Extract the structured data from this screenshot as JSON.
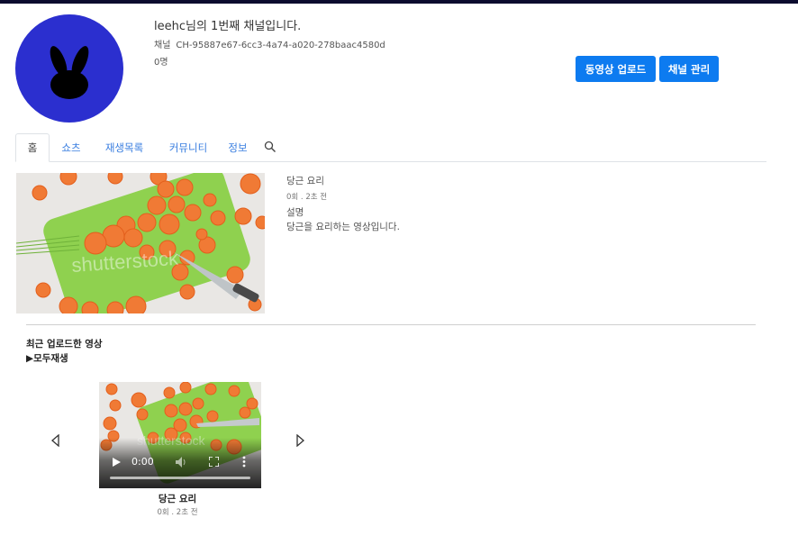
{
  "channel": {
    "name": "leehc님의 1번째 채널입니다.",
    "id_label": "채널",
    "id_value": "CH-95887e67-6cc3-4a74-a020-278baac4580d",
    "subscribers": "0명"
  },
  "actions": {
    "upload_label": "동영상 업로드",
    "manage_label": "채널 관리"
  },
  "tabs": [
    {
      "label": "홈",
      "active": true
    },
    {
      "label": "쇼츠",
      "active": false
    },
    {
      "label": "재생목록",
      "active": false
    },
    {
      "label": "커뮤니티",
      "active": false
    },
    {
      "label": "정보",
      "active": false
    }
  ],
  "featured": {
    "title": "당근 요리",
    "meta": "0회 . 2초 전",
    "desc_label": "설명",
    "description": "당근을 요리하는 영상입니다."
  },
  "recent": {
    "section_title": "최근 업로드한 영상",
    "play_all": "▶모두재생",
    "video": {
      "time": "0:00",
      "title": "당근 요리",
      "meta": "0회 . 2초 전"
    }
  },
  "icons": {
    "avatar": "rabbit-icon",
    "search": "search-icon",
    "prev": "chevron-left-icon",
    "next": "chevron-right-icon",
    "play": "play-icon",
    "volume": "volume-icon",
    "fullscreen": "fullscreen-icon",
    "more": "more-vertical-icon"
  },
  "colors": {
    "accent": "#0d7bf0",
    "avatar_bg": "#2b2fcf",
    "tab_link": "#3b7fe0",
    "top_bar": "#0b0b2e"
  }
}
